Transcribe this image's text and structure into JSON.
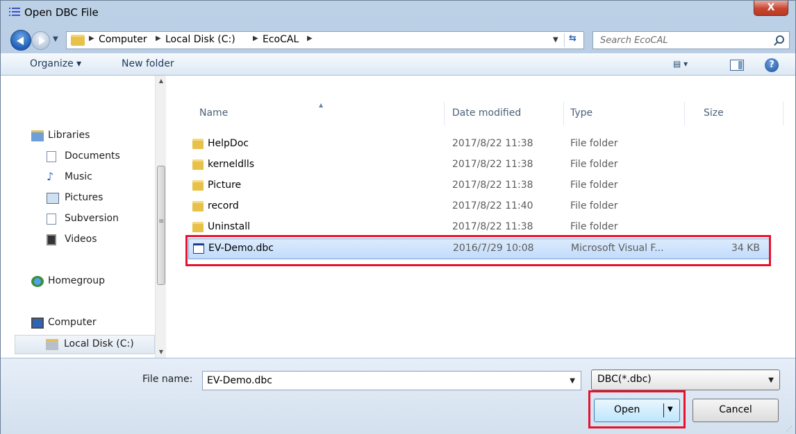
{
  "window": {
    "title": "Open DBC File",
    "close_label": "X"
  },
  "address": {
    "crumbs": [
      "Computer",
      "Local Disk (C:)",
      "EcoCAL"
    ],
    "search_placeholder": "Search EcoCAL"
  },
  "toolbar": {
    "organize_label": "Organize ▾",
    "new_folder_label": "New folder",
    "views_label": "▤ ▾",
    "help_label": "?"
  },
  "nav": {
    "items": [
      {
        "label": "Libraries",
        "icon": "libraries-icon"
      },
      {
        "label": "Documents",
        "icon": "documents-icon"
      },
      {
        "label": "Music",
        "icon": "music-icon"
      },
      {
        "label": "Pictures",
        "icon": "pictures-icon"
      },
      {
        "label": "Subversion",
        "icon": "subversion-icon"
      },
      {
        "label": "Videos",
        "icon": "videos-icon"
      },
      {
        "label": "Homegroup",
        "icon": "homegroup-icon"
      },
      {
        "label": "Computer",
        "icon": "computer-icon"
      },
      {
        "label": "Local Disk (C:)",
        "icon": "local-disk-icon"
      }
    ]
  },
  "files": {
    "columns": [
      "Name",
      "Date modified",
      "Type",
      "Size"
    ],
    "rows": [
      {
        "name": "HelpDoc",
        "date": "2017/8/22 11:38",
        "type": "File folder",
        "size": ""
      },
      {
        "name": "kerneldlls",
        "date": "2017/8/22 11:38",
        "type": "File folder",
        "size": ""
      },
      {
        "name": "Picture",
        "date": "2017/8/22 11:38",
        "type": "File folder",
        "size": ""
      },
      {
        "name": "record",
        "date": "2017/8/22 11:40",
        "type": "File folder",
        "size": ""
      },
      {
        "name": "Uninstall",
        "date": "2017/8/22 11:38",
        "type": "File folder",
        "size": ""
      },
      {
        "name": "EV-Demo.dbc",
        "date": "2016/7/29 10:08",
        "type": "Microsoft Visual F...",
        "size": "34 KB"
      }
    ]
  },
  "footer": {
    "file_name_label": "File name:",
    "file_name_value": "EV-Demo.dbc",
    "file_type_value": "DBC(*.dbc)",
    "open_label": "Open",
    "cancel_label": "Cancel"
  },
  "colors": {
    "highlight": "#e8112d",
    "selection": "#c1dcfc"
  }
}
